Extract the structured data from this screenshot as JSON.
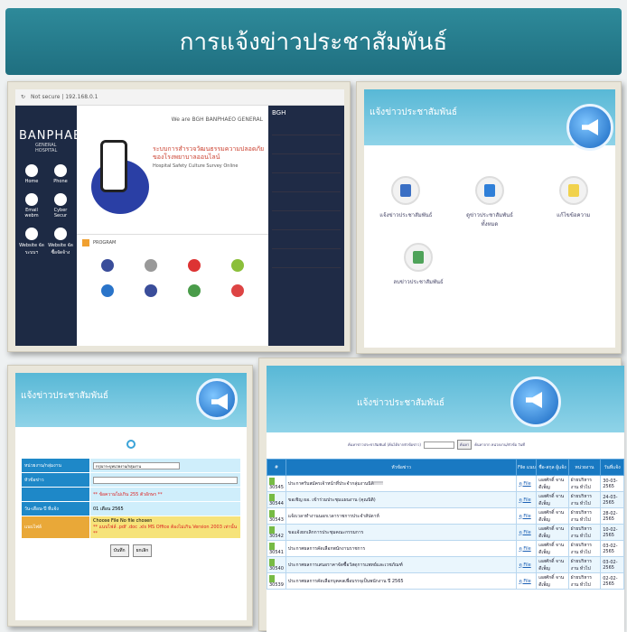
{
  "page_title": "การแจ้งข่าวประชาสัมพันธ์",
  "website_screenshot": {
    "brand": "BANPHAEO",
    "subbrand": "GENERAL  HOSPITAL",
    "topbar": "We are BGH  BANPHAEO GENERAL",
    "hero_line1": "ระบบการสำรวจวัฒนธรรมความปลอดภัย",
    "hero_line2": "ของโรงพยาบาลออนไลน์",
    "hero_line3": "Hospital Safety Culture Survey Online",
    "program_label": "PROGRAM",
    "nav_items": [
      "Home",
      "Phone",
      "Email webm",
      "Cyber Secur",
      "Website จัดระบบฯ",
      "Website จัดซื้อจัดจ้าง"
    ],
    "news_heading": "BGH"
  },
  "admin_menu": {
    "header": "แจ้งข่าวประชาสัมพันธ์",
    "icons": [
      {
        "label": "แจ้งข่าวประชาสัมพันธ์",
        "icon": "save-disk-icon",
        "color": "#3a6fc4"
      },
      {
        "label": "ดูข่าวประชาสัมพันธ์ทั้งหมด",
        "icon": "book-icon",
        "color": "#2f7fd8"
      },
      {
        "label": "แก้ไขข้อความ",
        "icon": "notepad-icon",
        "color": "#f1d24c"
      },
      {
        "label": "ลบข่าวประชาสัมพันธ์",
        "icon": "recycle-bin-icon",
        "color": "#4fa35a"
      }
    ]
  },
  "post_form": {
    "header": "แจ้งข่าวประชาสัมพันธ์",
    "rows": [
      {
        "label": "หน่วยงาน/กลุ่มงาน",
        "value": "กรุณาระบุหน่วยงาน/กลุ่มงาน"
      },
      {
        "label": "หัวข้อข่าว",
        "value": ""
      },
      {
        "label": "",
        "value": "** ข้อความไม่เกิน 255 ตัวอักษร **"
      },
      {
        "label": "วัน-เดือน-ปี ที่แจ้ง",
        "value": "01 เดือน 2565"
      },
      {
        "label": "แนบไฟล์",
        "value": "Choose File  No file chosen"
      }
    ],
    "file_note": "** แนบไฟล์ .pdf .doc .xls MS Office ต้องไม่เกิน Version 2003 เท่านั้น **",
    "submit": "บันทึก",
    "reset": "ยกเลิก"
  },
  "news_list": {
    "header": "แจ้งข่าวประชาสัมพันธ์",
    "search_hint": "ค้นหาข่าวประชาสัมพันธ์ (ค้นได้จากหัวข้อข่าว)",
    "search_button": "ค้นหา",
    "search_note": "ค้นหาจาก หน่วยงาน/หัวข้อ วันที่",
    "columns": [
      "#",
      "หัวข้อข่าว",
      "File แนบ",
      "ชื่อ-สกุล ผู้แจ้ง",
      "หน่วยงาน",
      "วันที่แจ้ง"
    ],
    "rows": [
      {
        "id": "30545",
        "title": "ประกาศรับสมัครเจ้าหน้าที่ประจำกลุ่มงานนิติ!!!!!",
        "file": "ดู File",
        "name": "เอสศักดิ์ จาน ดีเพ็ญ",
        "dept": "ฝ่ายบริหารงาน ทั่วไป",
        "date": "30-03-2565"
      },
      {
        "id": "30544",
        "title": "ขอเชิญ ผอ. เข้าร่วมประชุมแผนงาน (คุณนิติ)",
        "file": "ดู File",
        "name": "เอสศักดิ์ จาน ดีเพ็ญ",
        "dept": "ฝ่ายบริหารงาน ทั่วไป",
        "date": "24-03-2565"
      },
      {
        "id": "30543",
        "title": "แจ้งเวลาทำงานนอกเวลาราชการประจำสัปดาห์",
        "file": "ดู File",
        "name": "เอสศักดิ์ จาน ดีเพ็ญ",
        "dept": "ฝ่ายบริหารงาน ทั่วไป",
        "date": "28-02-2565"
      },
      {
        "id": "30542",
        "title": "ขอแจ้งยกเลิกการประชุมคณะกรรมการ",
        "file": "ดู File",
        "name": "เอสศักดิ์ จาน ดีเพ็ญ",
        "dept": "ฝ่ายบริหารงาน ทั่วไป",
        "date": "10-02-2565"
      },
      {
        "id": "30541",
        "title": "ประกาศผลการคัดเลือกพนักงานราชการ",
        "file": "ดู File",
        "name": "เอสศักดิ์ จาน ดีเพ็ญ",
        "dept": "ฝ่ายบริหารงาน ทั่วไป",
        "date": "03-02-2565"
      },
      {
        "id": "30540",
        "title": "ประกาศผลการเสนอราคาจัดซื้อวัสดุการแพทย์และเวชภัณฑ์",
        "file": "ดู File",
        "name": "เอสศักดิ์ จาน ดีเพ็ญ",
        "dept": "ฝ่ายบริหารงาน ทั่วไป",
        "date": "03-02-2565"
      },
      {
        "id": "30539",
        "title": "ประกาศผลการคัดเลือกบุคคลเพื่อบรรจุเป็นพนักงาน ปี 2565",
        "file": "ดู File",
        "name": "เอสศักดิ์ จาน ดีเพ็ญ",
        "dept": "ฝ่ายบริหารงาน ทั่วไป",
        "date": "02-02-2565"
      }
    ]
  }
}
